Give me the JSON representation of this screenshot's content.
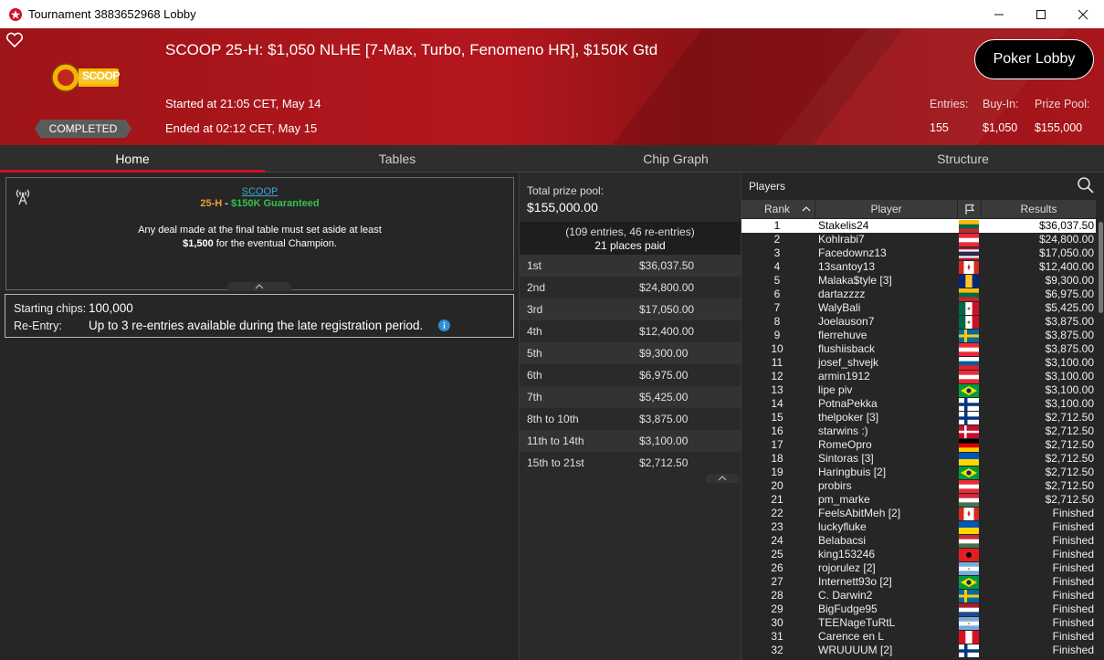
{
  "window": {
    "title": "Tournament 3883652968 Lobby"
  },
  "header": {
    "tournament_name": "SCOOP 25-H: $1,050 NLHE [7-Max, Turbo, Fenomeno HR], $150K Gtd",
    "status": "COMPLETED",
    "started": "Started at 21:05 CET, May 14",
    "ended": "Ended at 02:12 CET, May 15",
    "lobby_button": "Poker Lobby",
    "stats": {
      "entries_label": "Entries:",
      "entries": "155",
      "buyin_label": "Buy-In:",
      "buyin": "$1,050",
      "prize_label": "Prize Pool:",
      "prize": "$155,000"
    },
    "logo_text": "SCOOP"
  },
  "tabs": [
    "Home",
    "Tables",
    "Chip Graph",
    "Structure"
  ],
  "home": {
    "info_link": "SCOOP",
    "event_code": "25-H",
    "separator": " - ",
    "guarantee": "$150K Guaranteed",
    "deal_line1": "Any deal made at the final table must set aside at least",
    "deal_amount": "$1,500",
    "deal_line2": " for the eventual Champion.",
    "starting_chips_label": "Starting chips:",
    "starting_chips": "100,000",
    "reentry_label": "Re-Entry:",
    "reentry": "Up to 3 re-entries available during the late registration period."
  },
  "prizes": {
    "total_label": "Total prize pool:",
    "total": "$155,000.00",
    "entries_text": "(109 entries, 46 re-entries)",
    "places_paid": "21 places paid",
    "rows": [
      {
        "place": "1st",
        "amount": "$36,037.50"
      },
      {
        "place": "2nd",
        "amount": "$24,800.00"
      },
      {
        "place": "3rd",
        "amount": "$17,050.00"
      },
      {
        "place": "4th",
        "amount": "$12,400.00"
      },
      {
        "place": "5th",
        "amount": "$9,300.00"
      },
      {
        "place": "6th",
        "amount": "$6,975.00"
      },
      {
        "place": "7th",
        "amount": "$5,425.00"
      },
      {
        "place": "8th to 10th",
        "amount": "$3,875.00"
      },
      {
        "place": "11th to 14th",
        "amount": "$3,100.00"
      },
      {
        "place": "15th to 21st",
        "amount": "$2,712.50"
      }
    ]
  },
  "players": {
    "title": "Players",
    "headers": {
      "rank": "Rank",
      "player": "Player",
      "results": "Results"
    },
    "rows": [
      {
        "rank": "1",
        "name": "Stakelis24",
        "flag": "lithuania",
        "result": "$36,037.50"
      },
      {
        "rank": "2",
        "name": "Kohlrabi7",
        "flag": "austria",
        "result": "$24,800.00"
      },
      {
        "rank": "3",
        "name": "Facedownz13",
        "flag": "thailand",
        "result": "$17,050.00"
      },
      {
        "rank": "4",
        "name": "13santoy13",
        "flag": "canada",
        "result": "$12,400.00"
      },
      {
        "rank": "5",
        "name": "Malaka$tyle [3]",
        "flag": "barbados",
        "result": "$9,300.00"
      },
      {
        "rank": "6",
        "name": "dartazzzz",
        "flag": "lithuania",
        "result": "$6,975.00"
      },
      {
        "rank": "7",
        "name": "WalyBali",
        "flag": "mexico",
        "result": "$5,425.00"
      },
      {
        "rank": "8",
        "name": "Joelauson7",
        "flag": "mexico",
        "result": "$3,875.00"
      },
      {
        "rank": "9",
        "name": "flerrehuve",
        "flag": "sweden",
        "result": "$3,875.00"
      },
      {
        "rank": "10",
        "name": "flushiisback",
        "flag": "austria",
        "result": "$3,875.00"
      },
      {
        "rank": "11",
        "name": "josef_shvejk",
        "flag": "slovenia",
        "result": "$3,100.00"
      },
      {
        "rank": "12",
        "name": "armin1912",
        "flag": "austria",
        "result": "$3,100.00"
      },
      {
        "rank": "13",
        "name": "lipe piv",
        "flag": "brazil",
        "result": "$3,100.00"
      },
      {
        "rank": "14",
        "name": "PotnaPekka",
        "flag": "finland",
        "result": "$3,100.00"
      },
      {
        "rank": "15",
        "name": "thelpoker [3]",
        "flag": "finland",
        "result": "$2,712.50"
      },
      {
        "rank": "16",
        "name": "starwins :)",
        "flag": "denmark",
        "result": "$2,712.50"
      },
      {
        "rank": "17",
        "name": "RomeOpro",
        "flag": "germany",
        "result": "$2,712.50"
      },
      {
        "rank": "18",
        "name": "Sintoras [3]",
        "flag": "ukraine",
        "result": "$2,712.50"
      },
      {
        "rank": "19",
        "name": "Haringbuis [2]",
        "flag": "brazil",
        "result": "$2,712.50"
      },
      {
        "rank": "20",
        "name": "probirs",
        "flag": "austria",
        "result": "$2,712.50"
      },
      {
        "rank": "21",
        "name": "pm_marke",
        "flag": "hungary",
        "result": "$2,712.50"
      },
      {
        "rank": "22",
        "name": "FeelsAbitMeh [2]",
        "flag": "canada",
        "result": "Finished"
      },
      {
        "rank": "23",
        "name": "luckyfluke",
        "flag": "ukraine",
        "result": "Finished"
      },
      {
        "rank": "24",
        "name": "Belabacsi",
        "flag": "hungary",
        "result": "Finished"
      },
      {
        "rank": "25",
        "name": "king153246",
        "flag": "albania",
        "result": "Finished"
      },
      {
        "rank": "26",
        "name": "rojorulez [2]",
        "flag": "argentina",
        "result": "Finished"
      },
      {
        "rank": "27",
        "name": "Internett93o [2]",
        "flag": "brazil",
        "result": "Finished"
      },
      {
        "rank": "28",
        "name": "C. Darwin2",
        "flag": "sweden",
        "result": "Finished"
      },
      {
        "rank": "29",
        "name": "BigFudge95",
        "flag": "netherlands",
        "result": "Finished"
      },
      {
        "rank": "30",
        "name": "TEENageTuRtL",
        "flag": "argentina",
        "result": "Finished"
      },
      {
        "rank": "31",
        "name": "Carence en L",
        "flag": "peru",
        "result": "Finished"
      },
      {
        "rank": "32",
        "name": "WRUUUUM [2]",
        "flag": "finland",
        "result": "Finished"
      }
    ]
  },
  "colors": {
    "accent_red": "#d0102a",
    "banner_red": "#b3171d",
    "guarantee_code": "#f0a030",
    "guarantee_text": "#33c24d",
    "link_blue": "#3fa9d6"
  }
}
